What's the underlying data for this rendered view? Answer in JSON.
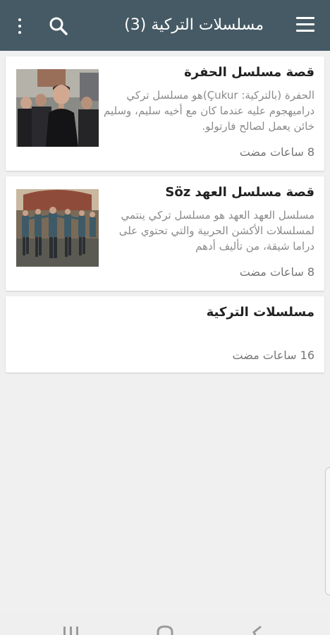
{
  "appbar": {
    "title": "مسلسلات التركية (3)",
    "icons": [
      "menu-icon",
      "search-icon",
      "more-vert-icon"
    ],
    "color": "#455a64"
  },
  "cards": [
    {
      "title": "قصة مسلسل الحفرة",
      "description": "الحفرة (بالتركية: Çukur)هو مسلسل تركي دراميهجوم عليه عندما كان مع أخيه سليم، وسليم خائن يعمل لصالح فارتولو.",
      "time": "8 ساعات مضت",
      "image": "man-in-black-jacket-with-group"
    },
    {
      "title": "قصة مسلسل العهد Söz",
      "description": "مسلسل العهد العهد هو مسلسل تركي ينتمي لمسلسلات الأكشن الحربية والتي تحتوي على دراما شيقة، من تأليف أدهم",
      "time": "8 ساعات مضت",
      "image": "soldiers-dancing-in-courtyard"
    },
    {
      "title": "مسلسلات التركية",
      "time": "16 ساعات مضت"
    }
  ]
}
